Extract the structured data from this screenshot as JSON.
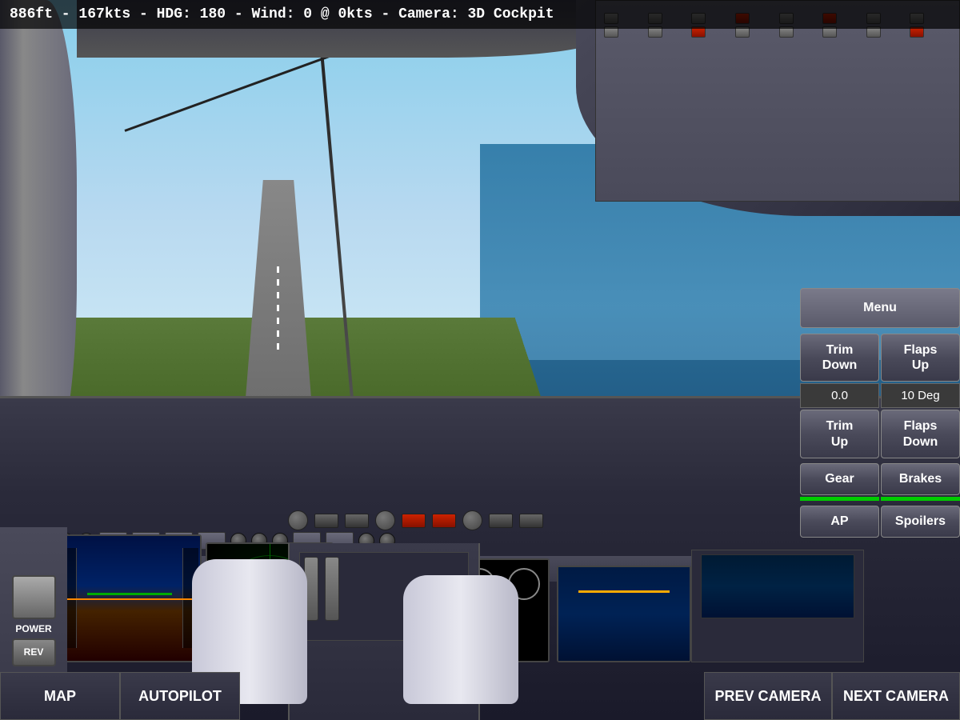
{
  "hud": {
    "status_text": "886ft - 167kts - HDG: 180 - Wind: 0 @ 0kts - Camera: 3D Cockpit"
  },
  "controls": {
    "menu_label": "Menu",
    "trim_down_label": "Trim\nDown",
    "trim_up_label": "Trim\nUp",
    "flaps_up_label": "Flaps\nUp",
    "flaps_down_label": "Flaps\nDown",
    "trim_value": "0.0",
    "flaps_value": "10 Deg",
    "gear_label": "Gear",
    "brakes_label": "Brakes",
    "ap_label": "AP",
    "spoilers_label": "Spoilers",
    "gear_indicator_active": true,
    "brakes_indicator_active": true
  },
  "bottom_buttons": {
    "map_label": "MAP",
    "autopilot_label": "AUTOPILOT",
    "prev_camera_label": "PREV CAMERA",
    "next_camera_label": "NEXT CAMERA"
  },
  "left_panel": {
    "power_label": "POWER",
    "rev_label": "REV"
  }
}
